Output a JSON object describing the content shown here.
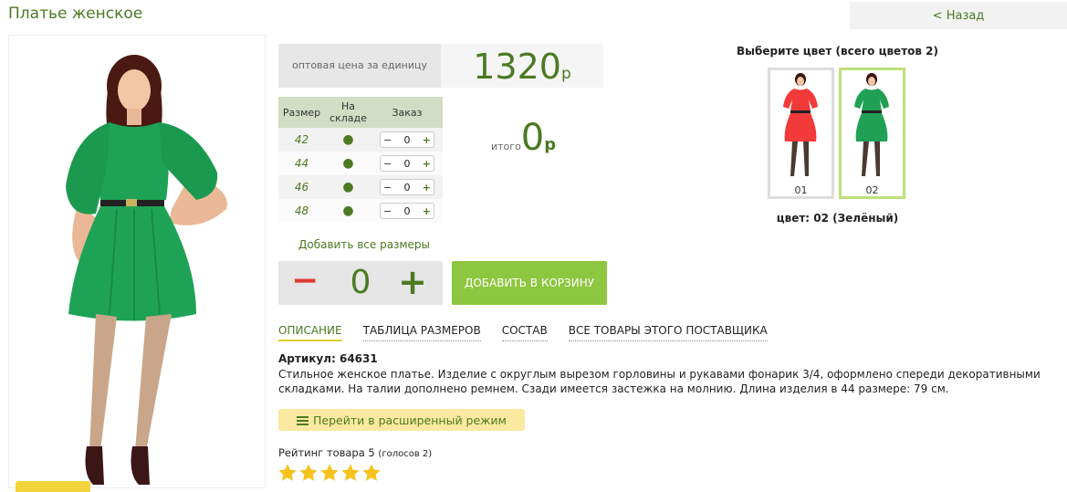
{
  "header": {
    "title": "Платье женское",
    "back_label": "< Назад"
  },
  "price": {
    "label": "оптовая цена за единицу",
    "value": "1320",
    "currency": "р"
  },
  "sizes_table": {
    "headers": [
      "Размер",
      "На складе",
      "Заказ"
    ],
    "rows": [
      {
        "size": "42",
        "in_stock": "●",
        "qty": "0"
      },
      {
        "size": "44",
        "in_stock": "●",
        "qty": "0"
      },
      {
        "size": "46",
        "in_stock": "●",
        "qty": "0"
      },
      {
        "size": "48",
        "in_stock": "●",
        "qty": "0"
      }
    ],
    "minus": "−",
    "plus": "+"
  },
  "total": {
    "label": "итого",
    "value": "0",
    "currency": "р"
  },
  "add_all_label": "Добавить все размеры",
  "big_stepper": {
    "minus": "−",
    "value": "0",
    "plus": "+"
  },
  "cart_button_label": "ДОБАВИТЬ В КОРЗИНУ",
  "tabs": [
    {
      "label": "ОПИСАНИЕ",
      "active": true
    },
    {
      "label": "ТАБЛИЦА РАЗМЕРОВ",
      "active": false
    },
    {
      "label": "СОСТАВ",
      "active": false
    },
    {
      "label": "ВСЕ ТОВАРЫ ЭТОГО ПОСТАВЩИКА",
      "active": false
    }
  ],
  "article": "Артикул: 64631",
  "description": "Стильное женское платье. Изделие с округлым вырезом горловины и рукавами фонарик 3/4, оформлено спереди декоративными складками. На талии дополнено ремнем. Сзади имеется застежка на молнию. Длина изделия в 44 размере: 79 см.",
  "advanced_mode_label": "Перейти в расширенный режим",
  "rating": {
    "label": "Рейтинг товара 5",
    "votes": "(голосов 2)",
    "stars": 5
  },
  "colors": {
    "title": "Выберите цвет (всего цветов 2)",
    "items": [
      {
        "code": "01",
        "color": "#f23a3a"
      },
      {
        "code": "02",
        "color": "#1fa055"
      }
    ],
    "current": "цвет: 02 (Зелёный)"
  },
  "product_color": "#1ea356"
}
